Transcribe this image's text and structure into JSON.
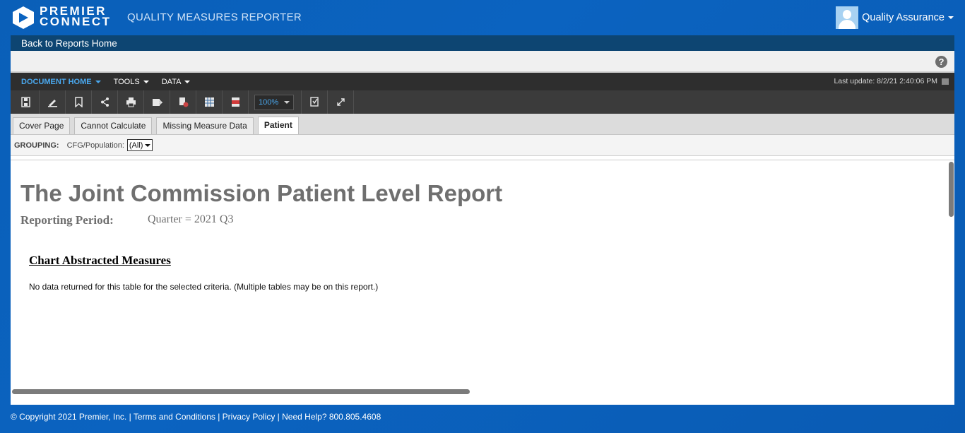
{
  "header": {
    "brand_line1": "PREMIER",
    "brand_line2": "CONNECT",
    "app_title": "QUALITY MEASURES REPORTER",
    "user_name": "Quality Assurance"
  },
  "nav": {
    "back_label": "Back to Reports Home"
  },
  "help": {
    "icon": "help-icon",
    "glyph": "?"
  },
  "menu": {
    "items": [
      "DOCUMENT HOME",
      "TOOLS",
      "DATA"
    ],
    "last_update": "Last update: 8/2/21 2:40:06 PM"
  },
  "toolbar": {
    "icons": [
      "save-icon",
      "edit-icon",
      "bookmark-icon",
      "share-icon",
      "print-icon",
      "export-icon",
      "refresh-icon",
      "excel-icon",
      "pdf-icon"
    ],
    "zoom": "100%",
    "extra_icons": [
      "find-icon",
      "fullscreen-icon"
    ]
  },
  "tabs": [
    {
      "label": "Cover Page",
      "active": false
    },
    {
      "label": "Cannot Calculate",
      "active": false
    },
    {
      "label": "Missing Measure Data",
      "active": false
    },
    {
      "label": "Patient",
      "active": true
    }
  ],
  "grouping": {
    "label": "GROUPING:",
    "filter_label": "CFG/Population:",
    "filter_value": "(All)"
  },
  "report": {
    "title": "The Joint Commission Patient Level Report",
    "period_label": "Reporting Period:",
    "period_value": "Quarter = 2021 Q3",
    "section_title": "Chart Abstracted Measures",
    "no_data": "No data returned for this table for the selected criteria. (Multiple tables may be on this report.)"
  },
  "footer": {
    "text": "© Copyright 2021 Premier, Inc. | Terms and Conditions | Privacy Policy | Need Help? 800.805.4608"
  },
  "colors": {
    "background": "#0b63c0",
    "nav_bar": "#0d4572",
    "menu_bar": "#2e2e2e",
    "toolbar": "#3b3b3b",
    "active_menu": "#4aa8ee",
    "report_title": "#6f6f6f"
  }
}
